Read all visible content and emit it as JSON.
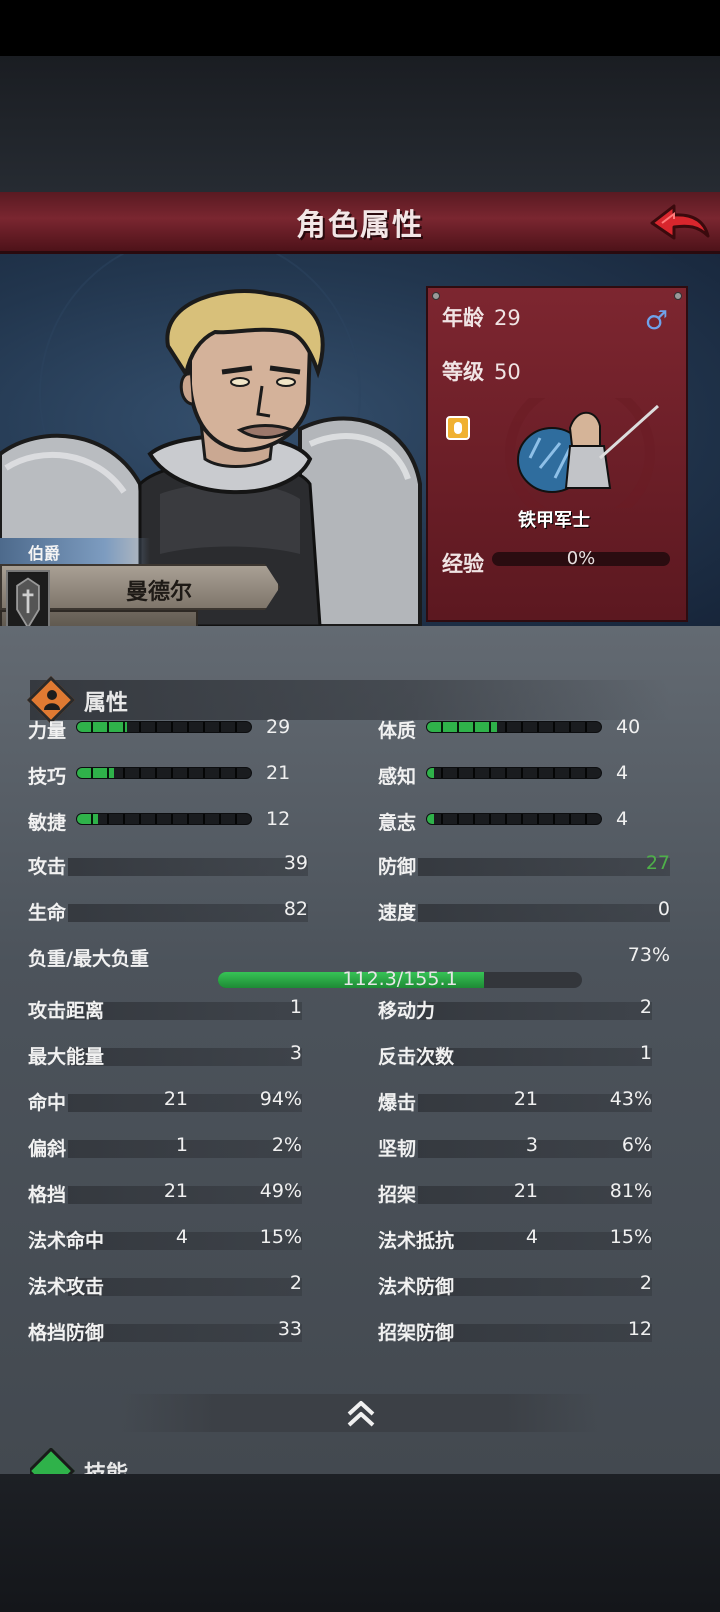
{
  "screen": {
    "title": "角色属性"
  },
  "character": {
    "rank": "伯爵",
    "name": "曼德尔",
    "age_label": "年龄",
    "age": "29",
    "level_label": "等级",
    "level": "50",
    "class_name": "铁甲军士",
    "exp_label": "经验",
    "exp": "0%"
  },
  "attributes_section": {
    "label": "属性"
  },
  "primary": [
    {
      "name": "力量",
      "value": "29",
      "fill": 0.29
    },
    {
      "name": "体质",
      "value": "40",
      "fill": 0.4
    },
    {
      "name": "技巧",
      "value": "21",
      "fill": 0.21
    },
    {
      "name": "感知",
      "value": "4",
      "fill": 0.04
    },
    {
      "name": "敏捷",
      "value": "12",
      "fill": 0.12
    },
    {
      "name": "意志",
      "value": "4",
      "fill": 0.04
    }
  ],
  "combat": {
    "attack": {
      "name": "攻击",
      "value": "39"
    },
    "defense": {
      "name": "防御",
      "value": "27",
      "color": "#4fb04a"
    },
    "hp": {
      "name": "生命",
      "value": "82"
    },
    "speed": {
      "name": "速度",
      "value": "0"
    }
  },
  "load": {
    "name": "负重/最大负重",
    "value": "112.3/155.1",
    "percent": "73%",
    "fraction": 0.73
  },
  "secondary": [
    {
      "name": "攻击距离",
      "v2": "1"
    },
    {
      "name": "移动力",
      "v2": "2"
    },
    {
      "name": "最大能量",
      "v2": "3"
    },
    {
      "name": "反击次数",
      "v2": "1"
    },
    {
      "name": "命中",
      "v1": "21",
      "v2": "94%"
    },
    {
      "name": "爆击",
      "v1": "21",
      "v2": "43%"
    },
    {
      "name": "偏斜",
      "v1": "1",
      "v2": "2%"
    },
    {
      "name": "坚韧",
      "v1": "3",
      "v2": "6%"
    },
    {
      "name": "格挡",
      "v1": "21",
      "v2": "49%"
    },
    {
      "name": "招架",
      "v1": "21",
      "v2": "81%"
    },
    {
      "name": "法术命中",
      "v1": "4",
      "v2": "15%"
    },
    {
      "name": "法术抵抗",
      "v1": "4",
      "v2": "15%"
    },
    {
      "name": "法术攻击",
      "v2": "2"
    },
    {
      "name": "法术防御",
      "v2": "2"
    },
    {
      "name": "格挡防御",
      "v2": "33"
    },
    {
      "name": "招架防御",
      "v2": "12"
    }
  ],
  "skills_section": {
    "label": "技能"
  },
  "colors": {
    "accent_red": "#7a2630",
    "bar_green": "#2fb24a",
    "male_blue": "#6fa2ea"
  },
  "icons": [
    "back-arrow-icon",
    "male-icon",
    "class-shield-icon",
    "attributes-icon",
    "collapse-chevron-icon",
    "skills-icon"
  ]
}
